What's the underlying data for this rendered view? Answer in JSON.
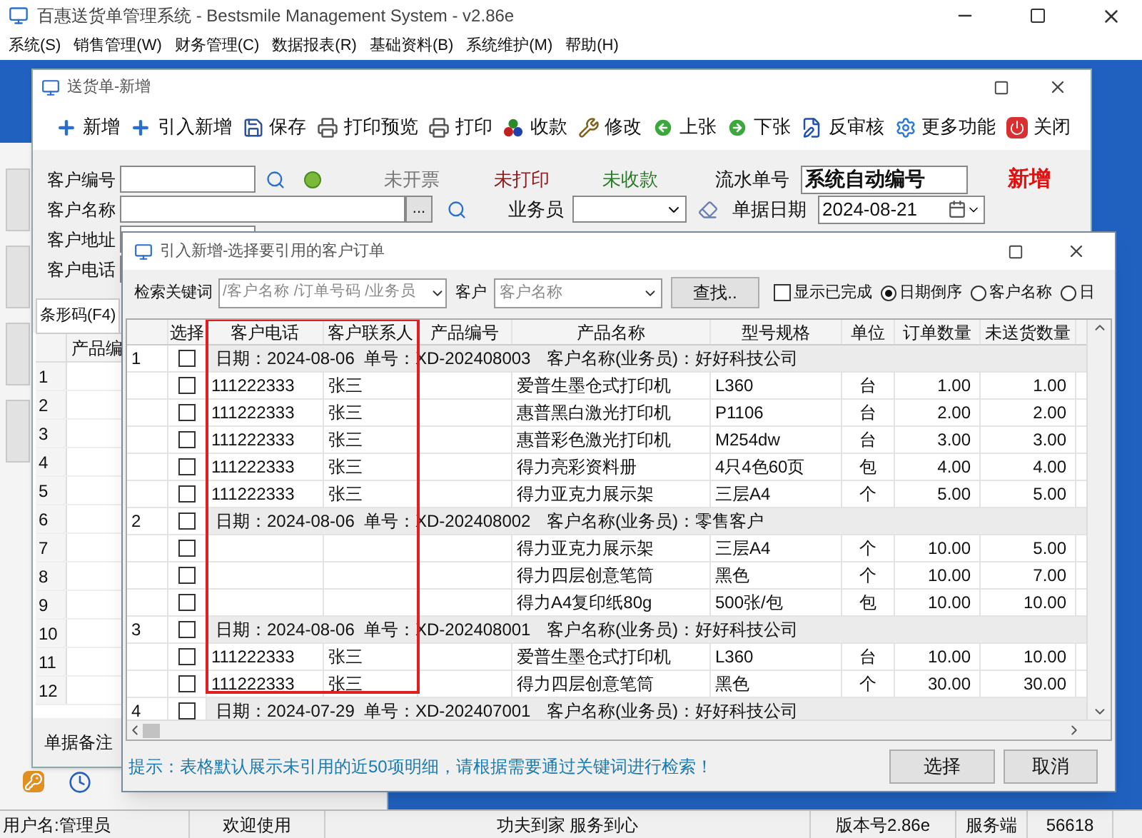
{
  "app_window": {
    "title": "百惠送货单管理系统 - Bestsmile Management System - v2.86e"
  },
  "menu": [
    "系统(S)",
    "销售管理(W)",
    "财务管理(C)",
    "数据报表(R)",
    "基础资料(B)",
    "系统维护(M)",
    "帮助(H)"
  ],
  "document_window": {
    "title": "送货单-新增",
    "toolbar": [
      "新增",
      "引入新增",
      "保存",
      "打印预览",
      "打印",
      "收款",
      "修改",
      "上张",
      "下张",
      "反审核",
      "更多功能",
      "关闭"
    ],
    "form": {
      "customer_code_label": "客户编号",
      "invoice_status": "未开票",
      "print_status": "未打印",
      "payment_status": "未收款",
      "serial_label": "流水单号",
      "serial_value": "系统自动编号",
      "mode_badge": "新增",
      "customer_name_label": "客户名称",
      "browse_button": "...",
      "salesperson_label": "业务员",
      "date_label": "单据日期",
      "date_value": "2024-08-21",
      "address_label": "客户地址",
      "phone_label": "客户电话"
    },
    "tab": "条形码(F4)",
    "table": {
      "column_1": "产品编",
      "row_numbers": [
        "1",
        "2",
        "3",
        "4",
        "5",
        "6",
        "7",
        "8",
        "9",
        "10",
        "11",
        "12"
      ]
    },
    "remark_label": "单据备注"
  },
  "dialog": {
    "title": "引入新增-选择要引用的客户订单",
    "search": {
      "keyword_label": "检索关键词",
      "keyword_placeholder": "/客户名称 /订单号码 /业务员",
      "customer_label": "客户",
      "customer_placeholder": "客户名称",
      "find_button": "查找..",
      "show_done": {
        "label": "显示已完成",
        "checked": false
      },
      "sort": [
        {
          "label": "日期倒序",
          "selected": true
        },
        {
          "label": "客户名称",
          "selected": false
        },
        {
          "label": "日",
          "selected": false
        }
      ]
    },
    "table": {
      "columns": [
        "选择",
        "客户电话",
        "客户联系人",
        "产品编号",
        "产品名称",
        "型号规格",
        "单位",
        "订单数量",
        "未送货数量"
      ],
      "groups": [
        {
          "number": "1",
          "checked": false,
          "date": "日期：2024-08-06",
          "order_no": "单号：XD-202408003",
          "customer": "客户名称(业务员)：好好科技公司",
          "items": [
            {
              "checked": false,
              "phone": "111222333",
              "contact": "张三",
              "product": "爱普生墨仓式打印机",
              "spec": "L360",
              "unit": "台",
              "qty": "1.00",
              "pending": "1.00"
            },
            {
              "checked": false,
              "phone": "111222333",
              "contact": "张三",
              "product": "惠普黑白激光打印机",
              "spec": "P1106",
              "unit": "台",
              "qty": "2.00",
              "pending": "2.00"
            },
            {
              "checked": false,
              "phone": "111222333",
              "contact": "张三",
              "product": "惠普彩色激光打印机",
              "spec": "M254dw",
              "unit": "台",
              "qty": "3.00",
              "pending": "3.00"
            },
            {
              "checked": false,
              "phone": "111222333",
              "contact": "张三",
              "product": "得力亮彩资料册",
              "spec": "4只4色60页",
              "unit": "包",
              "qty": "4.00",
              "pending": "4.00"
            },
            {
              "checked": false,
              "phone": "111222333",
              "contact": "张三",
              "product": "得力亚克力展示架",
              "spec": "三层A4",
              "unit": "个",
              "qty": "5.00",
              "pending": "5.00"
            }
          ]
        },
        {
          "number": "2",
          "checked": false,
          "date": "日期：2024-08-06",
          "order_no": "单号：XD-202408002",
          "customer": "客户名称(业务员)：零售客户",
          "items": [
            {
              "checked": false,
              "product": "得力亚克力展示架",
              "spec": "三层A4",
              "unit": "个",
              "qty": "10.00",
              "pending": "5.00"
            },
            {
              "checked": false,
              "product": "得力四层创意笔筒",
              "spec": "黑色",
              "unit": "个",
              "qty": "10.00",
              "pending": "7.00"
            },
            {
              "checked": false,
              "product": "得力A4复印纸80g",
              "spec": "500张/包",
              "unit": "包",
              "qty": "10.00",
              "pending": "10.00"
            }
          ]
        },
        {
          "number": "3",
          "checked": false,
          "date": "日期：2024-08-06",
          "order_no": "单号：XD-202408001",
          "customer": "客户名称(业务员)：好好科技公司",
          "items": [
            {
              "checked": false,
              "phone": "111222333",
              "contact": "张三",
              "product": "爱普生墨仓式打印机",
              "spec": "L360",
              "unit": "台",
              "qty": "10.00",
              "pending": "10.00"
            },
            {
              "checked": false,
              "phone": "111222333",
              "contact": "张三",
              "product": "得力四层创意笔筒",
              "spec": "黑色",
              "unit": "个",
              "qty": "30.00",
              "pending": "30.00"
            }
          ]
        },
        {
          "number": "4",
          "checked": false,
          "date": "日期：2024-07-29",
          "order_no": "单号：XD-202407001",
          "customer": "客户名称(业务员)：好好科技公司"
        }
      ]
    },
    "hint": "提示：表格默认展示未引用的近50项明细，请根据需要通过关键词进行检索！",
    "buttons": [
      "选择",
      "取消"
    ]
  },
  "status_bar": [
    "用户名:管理员",
    "欢迎使用",
    "功夫到家 服务到心",
    "版本号2.86e",
    "服务端",
    "56618"
  ]
}
